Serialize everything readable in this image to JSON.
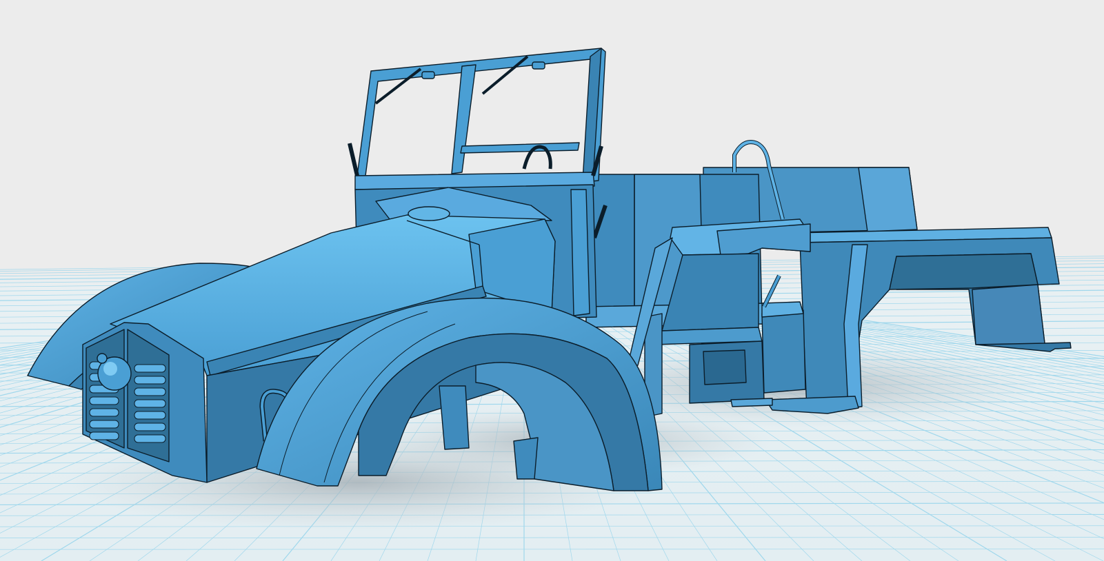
{
  "app": {
    "view": "3d-viewport",
    "background_color": "#ececec",
    "grid_color": "#9fd7ec",
    "grid_fill": "#e6eff2",
    "model_color": "#4a9fd4",
    "model_dark": "#2f6f96",
    "model_light": "#62b6e6",
    "edge_color": "#0b1d2a",
    "shadow_color": "#bcc3c7"
  },
  "model": {
    "name": "",
    "parts": [
      "hood",
      "radiator-grille",
      "headlight",
      "front-fender-left",
      "front-fender-right",
      "windshield-frame",
      "cab-body",
      "seat",
      "steering-column",
      "rear-fender",
      "cargo-bed",
      "side-step"
    ]
  }
}
